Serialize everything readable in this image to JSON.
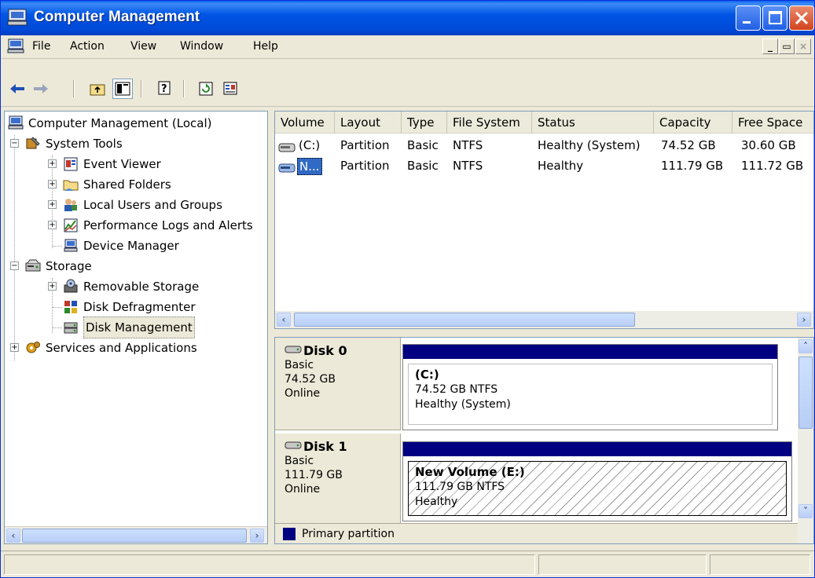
{
  "window": {
    "title": "Computer Management"
  },
  "menu": {
    "items": [
      "File",
      "Action",
      "View",
      "Window",
      "Help"
    ]
  },
  "tree": {
    "root": "Computer Management (Local)",
    "system_tools": "System Tools",
    "event_viewer": "Event Viewer",
    "shared_folders": "Shared Folders",
    "local_users": "Local Users and Groups",
    "perf_logs": "Performance Logs and Alerts",
    "device_manager": "Device Manager",
    "storage": "Storage",
    "removable_storage": "Removable Storage",
    "disk_defrag": "Disk Defragmenter",
    "disk_management": "Disk Management",
    "services_apps": "Services and Applications"
  },
  "volumes": {
    "columns": [
      "Volume",
      "Layout",
      "Type",
      "File System",
      "Status",
      "Capacity",
      "Free Space"
    ],
    "rows": [
      [
        "(C:)",
        "Partition",
        "Basic",
        "NTFS",
        "Healthy (System)",
        "74.52 GB",
        "30.60 GB"
      ],
      [
        "N...",
        "Partition",
        "Basic",
        "NTFS",
        "Healthy",
        "111.79 GB",
        "111.72 GB"
      ]
    ]
  },
  "disks": [
    {
      "name": "Disk 0",
      "type": "Basic",
      "size": "74.52 GB",
      "status": "Online",
      "vol_title": "(C:)",
      "vol_size": "74.52 GB NTFS",
      "vol_status": "Healthy (System)"
    },
    {
      "name": "Disk 1",
      "type": "Basic",
      "size": "111.79 GB",
      "status": "Online",
      "vol_title": "New Volume  (E:)",
      "vol_size": "111.79 GB NTFS",
      "vol_status": "Healthy"
    }
  ],
  "legend": {
    "primary": "Primary partition"
  },
  "colors": {
    "partition_bar": "#000080",
    "title_bar": "#0055e5",
    "close_button": "#d2431d"
  },
  "icons": {
    "toolbar": [
      "back-icon",
      "forward-icon",
      "up-one-level-icon",
      "show-hide-console-tree-icon",
      "help-icon",
      "refresh-icon",
      "properties-icon"
    ]
  }
}
